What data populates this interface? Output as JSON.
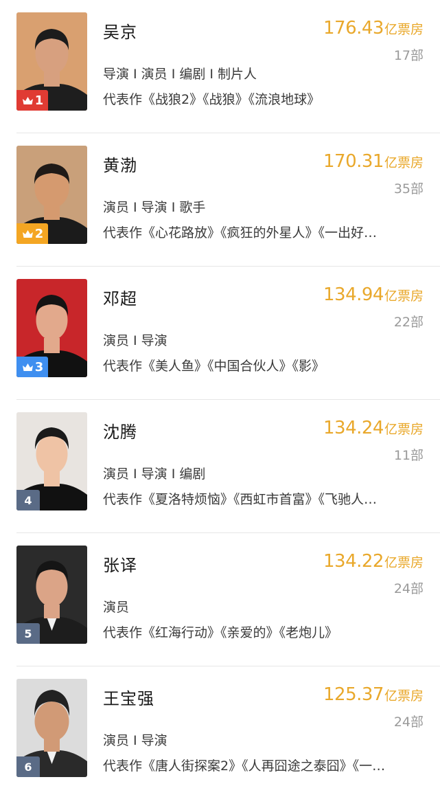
{
  "colors": {
    "box_office": "#e9a82b",
    "rank1_badge": "#e03b33",
    "rank2_badge": "#f4a623",
    "rank3_badge": "#3f8ff0",
    "rank_default_badge": "#5a6b86",
    "photo_bg": [
      "#d9a070",
      "#c9a07a",
      "#c8262a",
      "#e8e4e0",
      "#2b2b2b",
      "#dcdcdc"
    ],
    "skin": [
      "#d7a07f",
      "#d59a6f",
      "#e2a98c",
      "#efc3a5",
      "#dba487",
      "#d19a76"
    ],
    "hair": [
      "#1c1c1c",
      "#1f1a17",
      "#141414",
      "#1a1a1a",
      "#151515",
      "#222222"
    ],
    "clothes": [
      "#1e1e1e",
      "#1b1b1b",
      "#111111",
      "#111111",
      "#1d1d1d",
      "#2a2a2a"
    ]
  },
  "icons": {
    "rank_top": "crown-icon"
  },
  "people": [
    {
      "rank": "1",
      "name": "吴京",
      "amount": "176.43",
      "unit": "亿票房",
      "count": "17部",
      "roles": "导演 I 演员 I 编剧 I 制片人",
      "works": "代表作《战狼2》《战狼》《流浪地球》"
    },
    {
      "rank": "2",
      "name": "黄渤",
      "amount": "170.31",
      "unit": "亿票房",
      "count": "35部",
      "roles": "演员 I 导演 I 歌手",
      "works": "代表作《心花路放》《疯狂的外星人》《一出好…"
    },
    {
      "rank": "3",
      "name": "邓超",
      "amount": "134.94",
      "unit": "亿票房",
      "count": "22部",
      "roles": "演员 I 导演",
      "works": "代表作《美人鱼》《中国合伙人》《影》"
    },
    {
      "rank": "4",
      "name": "沈腾",
      "amount": "134.24",
      "unit": "亿票房",
      "count": "11部",
      "roles": "演员 I 导演 I 编剧",
      "works": "代表作《夏洛特烦恼》《西虹市首富》《飞驰人…"
    },
    {
      "rank": "5",
      "name": "张译",
      "amount": "134.22",
      "unit": "亿票房",
      "count": "24部",
      "roles": "演员",
      "works": "代表作《红海行动》《亲爱的》《老炮儿》"
    },
    {
      "rank": "6",
      "name": "王宝强",
      "amount": "125.37",
      "unit": "亿票房",
      "count": "24部",
      "roles": "演员 I 导演",
      "works": "代表作《唐人街探案2》《人再囧途之泰囧》《一…"
    }
  ]
}
